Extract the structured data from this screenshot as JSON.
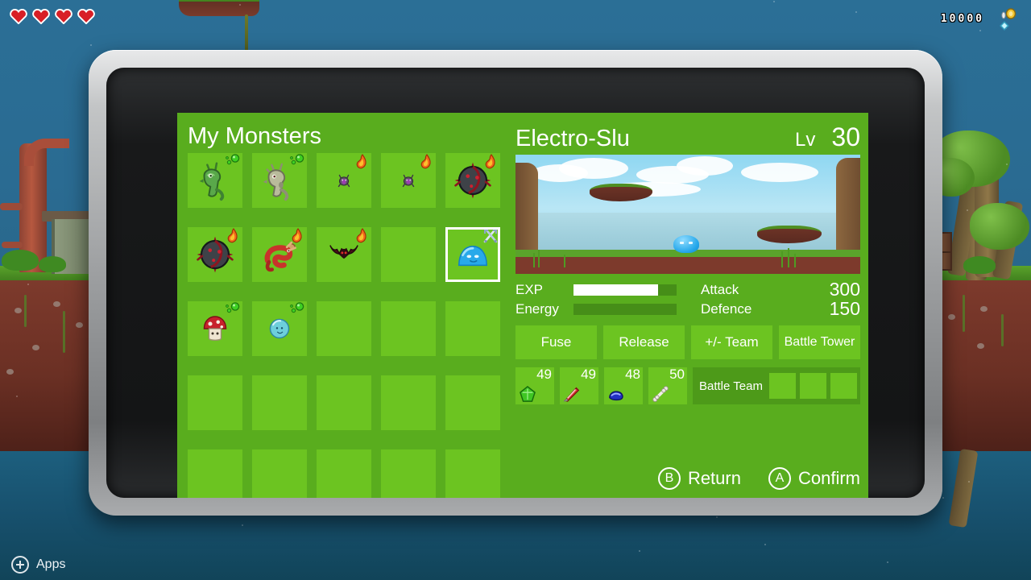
{
  "hud": {
    "hearts": 4,
    "heart_color": "#d81f26",
    "score": "10000",
    "coin_icon": "coin-icon",
    "gem_icon": "gem-icon",
    "apps_label": "Apps",
    "apps_icon": "plus-circle-icon"
  },
  "screen": {
    "panel_color": "#59ad1e",
    "cell_color": "#6cc421",
    "left": {
      "title": "My Monsters",
      "grid": {
        "columns": 5,
        "rows": 5,
        "cells": [
          {
            "monster": "green-dragon",
            "badge": "poison-icon",
            "empty": false,
            "selected": false
          },
          {
            "monster": "gray-dragon",
            "badge": "poison-icon",
            "empty": false,
            "selected": false
          },
          {
            "monster": "purple-bug",
            "badge": "fire-icon",
            "empty": false,
            "selected": false
          },
          {
            "monster": "purple-bug",
            "badge": "fire-icon",
            "empty": false,
            "selected": false
          },
          {
            "monster": "dark-spikeball",
            "badge": "fire-icon",
            "empty": false,
            "selected": false
          },
          {
            "monster": "dark-spikeball",
            "badge": "fire-icon",
            "empty": false,
            "selected": false
          },
          {
            "monster": "red-dragon",
            "badge": "fire-icon",
            "empty": false,
            "selected": false
          },
          {
            "monster": "dark-bat",
            "badge": "fire-icon",
            "empty": false,
            "selected": false
          },
          {
            "monster": "",
            "badge": "",
            "empty": true,
            "selected": false
          },
          {
            "monster": "blue-slime",
            "badge": "swords-icon",
            "empty": false,
            "selected": true
          },
          {
            "monster": "mushroom",
            "badge": "poison-icon",
            "empty": false,
            "selected": false
          },
          {
            "monster": "blue-orb",
            "badge": "poison-icon",
            "empty": false,
            "selected": false
          },
          {
            "monster": "",
            "badge": "",
            "empty": true,
            "selected": false
          },
          {
            "monster": "",
            "badge": "",
            "empty": true,
            "selected": false
          },
          {
            "monster": "",
            "badge": "",
            "empty": true,
            "selected": false
          },
          {
            "monster": "",
            "badge": "",
            "empty": true,
            "selected": false
          },
          {
            "monster": "",
            "badge": "",
            "empty": true,
            "selected": false
          },
          {
            "monster": "",
            "badge": "",
            "empty": true,
            "selected": false
          },
          {
            "monster": "",
            "badge": "",
            "empty": true,
            "selected": false
          },
          {
            "monster": "",
            "badge": "",
            "empty": true,
            "selected": false
          },
          {
            "monster": "",
            "badge": "",
            "empty": true,
            "selected": false
          },
          {
            "monster": "",
            "badge": "",
            "empty": true,
            "selected": false
          },
          {
            "monster": "",
            "badge": "",
            "empty": true,
            "selected": false
          },
          {
            "monster": "",
            "badge": "",
            "empty": true,
            "selected": false
          },
          {
            "monster": "",
            "badge": "",
            "empty": true,
            "selected": false
          }
        ]
      }
    },
    "detail": {
      "monster_name": "Electro-Slu",
      "level_label": "Lv",
      "level_value": "30",
      "preview_monster": "blue-slime",
      "stats": {
        "exp_label": "EXP",
        "exp_percent": 82,
        "exp_fill_color": "#ffffff",
        "energy_label": "Energy",
        "energy_percent": 0,
        "energy_fill_color": "#4d9c1a",
        "attack_label": "Attack",
        "attack_value": "300",
        "defence_label": "Defence",
        "defence_value": "150"
      },
      "buttons": [
        {
          "label": "Fuse",
          "name": "fuse-button"
        },
        {
          "label": "Release",
          "name": "release-button"
        },
        {
          "label": "+/- Team",
          "name": "team-button"
        },
        {
          "label": "Battle Tower",
          "name": "battle-tower-button"
        }
      ],
      "items": [
        {
          "count": "49",
          "icon": "green-gem-icon"
        },
        {
          "count": "49",
          "icon": "red-shard-icon"
        },
        {
          "count": "48",
          "icon": "blue-gem-icon"
        },
        {
          "count": "50",
          "icon": "bone-icon"
        }
      ],
      "battle_team": {
        "label": "Battle Team",
        "slots": [
          "",
          "",
          ""
        ]
      },
      "prompts": [
        {
          "key": "B",
          "label": "Return",
          "name": "return-prompt"
        },
        {
          "key": "A",
          "label": "Confirm",
          "name": "confirm-prompt"
        }
      ]
    }
  }
}
